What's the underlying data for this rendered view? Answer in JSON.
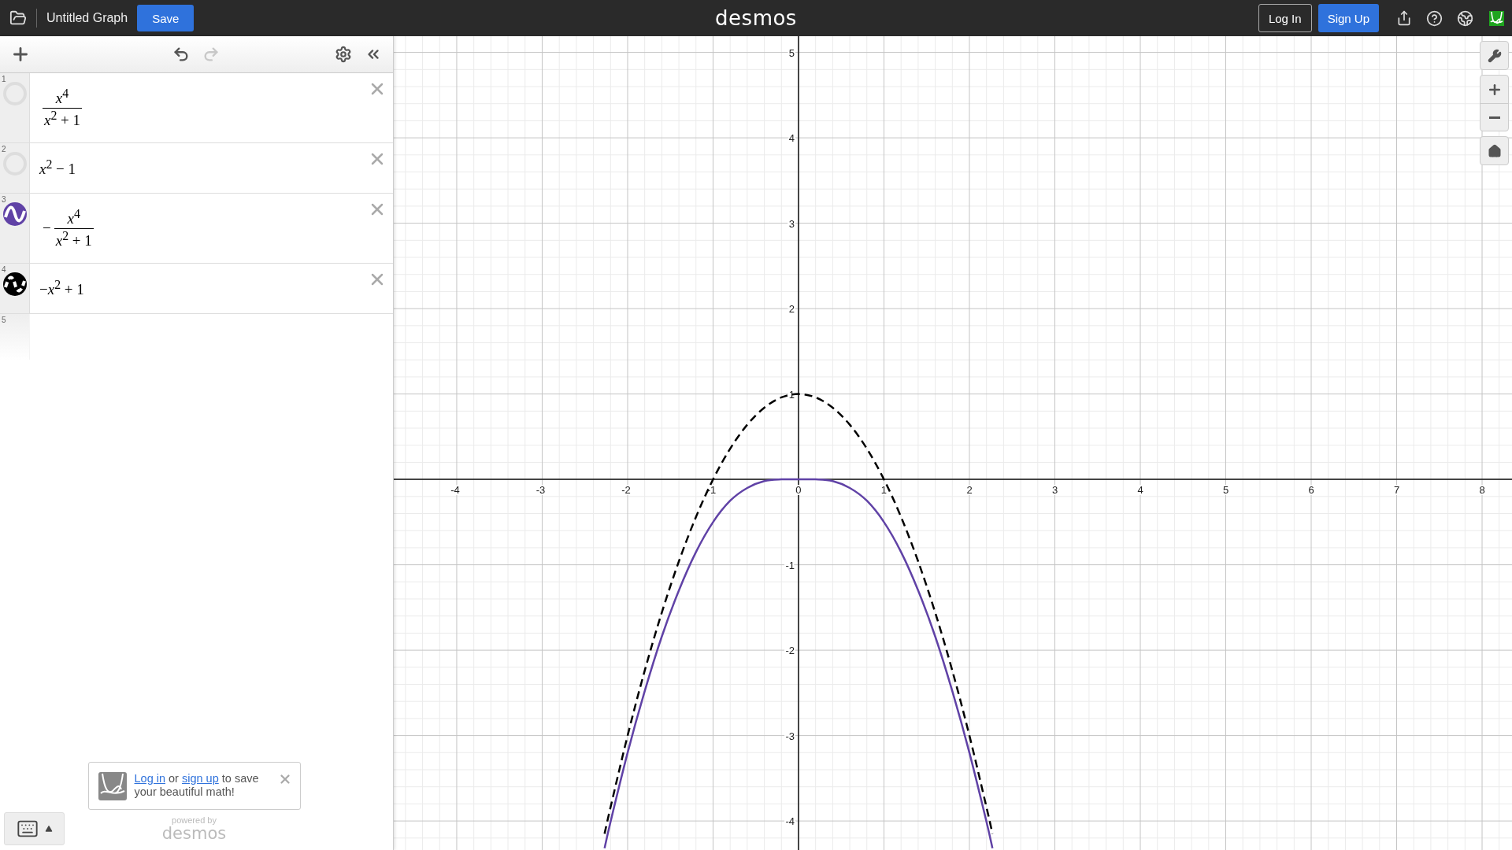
{
  "header": {
    "graph_title": "Untitled Graph",
    "save_label": "Save",
    "brand": "desmos",
    "login_label": "Log In",
    "signup_label": "Sign Up"
  },
  "toolbar": [
    {
      "kind": "add",
      "disabled": false
    },
    {
      "kind": "undo",
      "disabled": false
    },
    {
      "kind": "redo",
      "disabled": true
    },
    {
      "kind": "settings",
      "disabled": false
    },
    {
      "kind": "collapse",
      "disabled": false
    }
  ],
  "expressions": [
    {
      "number": "1",
      "visible": false,
      "kind": "fraction",
      "numerator": "*x*$^{4}$",
      "denominator": "*x*$^{2}$ + 1"
    },
    {
      "number": "2",
      "visible": false,
      "kind": "plain",
      "text": "*x*$^{2}$ − 1"
    },
    {
      "number": "3",
      "visible": true,
      "color": "#6042a6",
      "dashed": false,
      "kind": "fraction",
      "sign": "−",
      "numerator": "*x*$^{4}$",
      "denominator": "*x*$^{2}$ + 1"
    },
    {
      "number": "4",
      "visible": true,
      "color": "#000000",
      "dashed": true,
      "kind": "plain",
      "text": "−*x*$^{2}$ + 1"
    },
    {
      "number": "5",
      "kind": "empty"
    }
  ],
  "toast": {
    "parts": [
      {
        "kind": "link",
        "text": "Log in"
      },
      {
        "kind": "text",
        "text": " or "
      },
      {
        "kind": "link",
        "text": "sign up"
      },
      {
        "kind": "text",
        "text": " to save your beautiful math!"
      }
    ]
  },
  "footer": {
    "powered_by": "powered by",
    "brand": "desmos"
  },
  "graph": {
    "chart_data": {
      "type": "line",
      "x": [
        -2.27,
        -2.2,
        -2.0,
        -1.8,
        -1.6,
        -1.4,
        -1.2,
        -1.0,
        -0.8,
        -0.6,
        -0.4,
        -0.2,
        0,
        0.2,
        0.4,
        0.6,
        0.8,
        1.0,
        1.2,
        1.4,
        1.6,
        1.8,
        2.0,
        2.2,
        2.27
      ],
      "grid": true,
      "series": [
        {
          "color": "#6042a6",
          "line_style": "solid",
          "values": [
            -4.32,
            -4.01,
            -3.2,
            -2.48,
            -1.84,
            -1.3,
            -0.85,
            -0.5,
            -0.25,
            -0.1,
            -0.02,
            0,
            0,
            0,
            -0.02,
            -0.1,
            -0.25,
            -0.5,
            -0.85,
            -1.3,
            -1.84,
            -2.48,
            -3.2,
            -4.01,
            -4.32
          ]
        },
        {
          "color": "#000000",
          "line_style": "dashed",
          "values": [
            -4.15,
            -3.84,
            -3,
            -2.24,
            -1.56,
            -0.96,
            -0.44,
            0,
            0.36,
            0.64,
            0.84,
            0.96,
            1,
            0.96,
            0.84,
            0.64,
            0.36,
            0,
            -0.44,
            -0.96,
            -1.56,
            -2.24,
            -3,
            -3.84,
            -4.15
          ]
        }
      ],
      "xlim": [
        -4.737,
        8.35
      ],
      "ylim": [
        -4.34,
        5.19
      ],
      "xticks": [
        -4,
        -3,
        -2,
        -1,
        0,
        1,
        2,
        3,
        4,
        5,
        6,
        7,
        8
      ],
      "yticks": [
        -4,
        -3,
        -2,
        -1,
        1,
        2,
        3,
        4,
        5
      ]
    }
  }
}
